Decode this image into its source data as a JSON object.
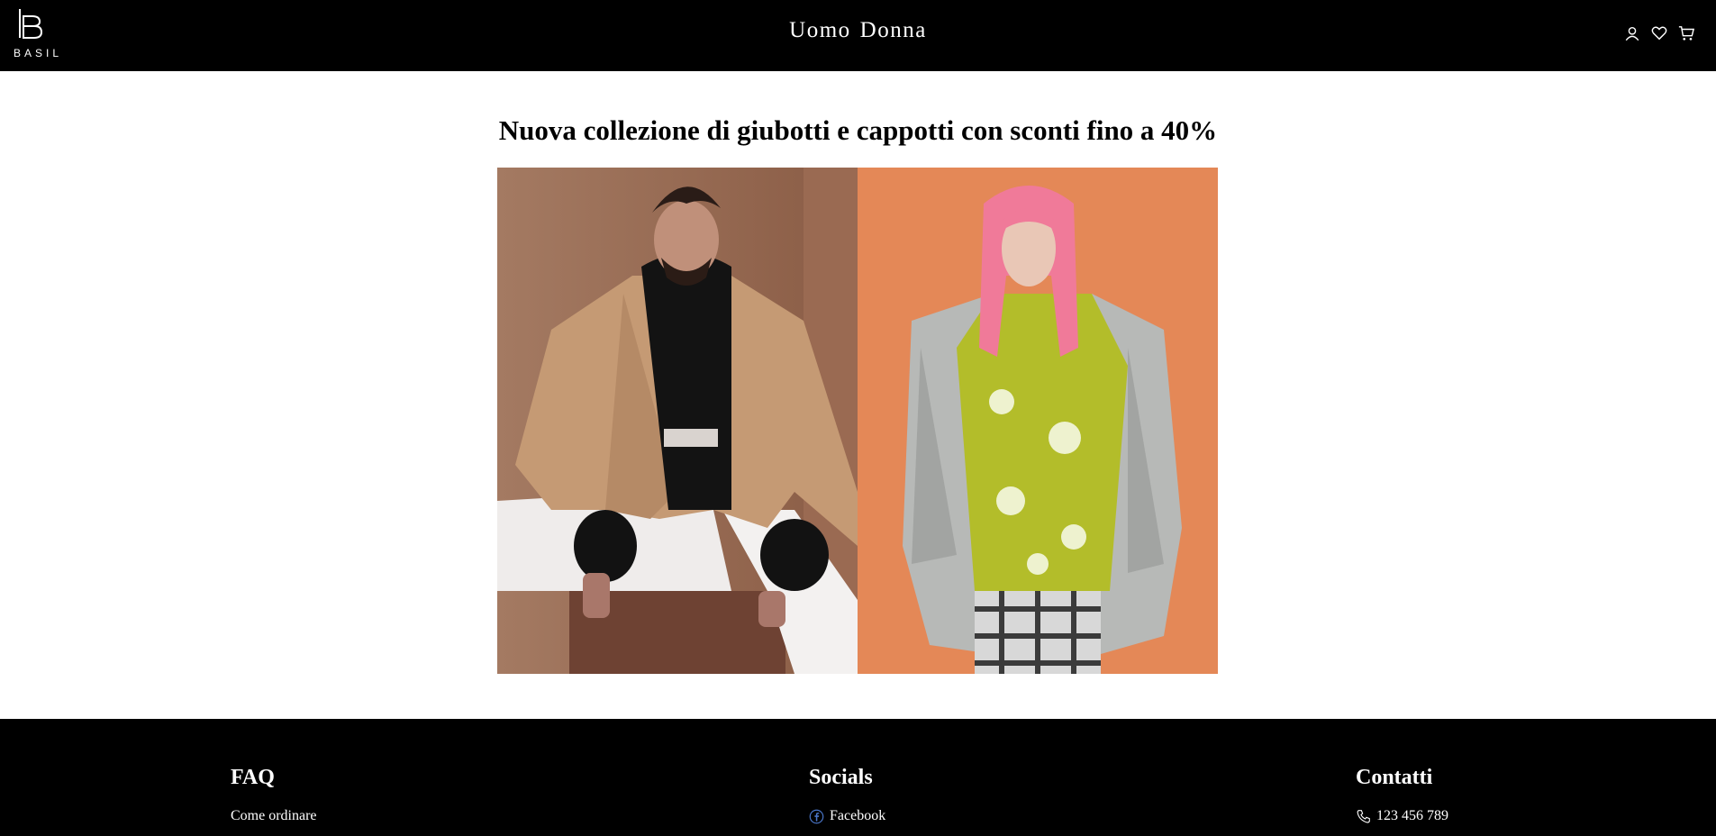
{
  "header": {
    "logo_text": "BASIL",
    "nav": [
      "Uomo",
      "Donna"
    ],
    "icons": [
      "user-icon",
      "heart-icon",
      "cart-icon"
    ]
  },
  "hero": {
    "title": "Nuova collezione di giubotti e cappotti con sconti fino a 40%",
    "images": [
      "man-camel-coat-photo",
      "woman-pink-hair-puffer-photo"
    ]
  },
  "footer": {
    "faq": {
      "heading": "FAQ",
      "links": [
        "Come ordinare"
      ]
    },
    "socials": {
      "heading": "Socials",
      "links": [
        "Facebook"
      ],
      "icon": "facebook-icon"
    },
    "contacts": {
      "heading": "Contatti",
      "phone": "123 456 789",
      "icon": "phone-icon"
    }
  },
  "colors": {
    "header_bg": "#000000",
    "footer_bg": "#000000",
    "page_bg": "#ffffff",
    "left_photo_bg": "#a0735c",
    "right_photo_bg": "#df8150"
  }
}
